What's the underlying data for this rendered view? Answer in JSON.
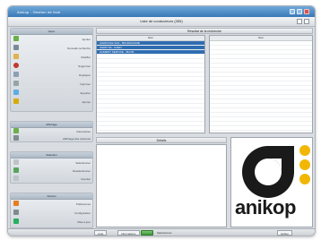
{
  "window": {
    "title": "Anikop - Gestion de liste",
    "subtitle": "Liste de conducteurs (355)"
  },
  "sidebar": {
    "sections": [
      {
        "title": "Gérer",
        "items": [
          "Ajouter",
          "Nouvelle recherche",
          "Modifier",
          "Supprimer",
          "Dupliquer",
          "Imprimer",
          "Exporter",
          "Aperçu"
        ]
      },
      {
        "title": "Affichage",
        "items": [
          "Paramètres",
          "Affichage des colonnes"
        ]
      },
      {
        "title": "Sélection",
        "items": [
          "Sélectionner",
          "Désélectionner",
          "Inverser"
        ]
      },
      {
        "title": "Options",
        "items": [
          "Préférences",
          "Configuration",
          "Mise à jour"
        ]
      }
    ]
  },
  "main": {
    "list_title": "Résultat de la recherche",
    "left_col": "Nom",
    "right_col": "Nom",
    "selected_rows": [
      "AGRICOLE SAS - BOURGOGNE",
      "AGRO SA - CAEN",
      "ALIMENT SERVICE - BLOIS"
    ],
    "detail_title": "Détails"
  },
  "logo": {
    "text": "anikop"
  },
  "status": {
    "tab1": "Liste",
    "tab2": "Informations",
    "left_text": "Sélectionner",
    "right_text": "Quitter"
  },
  "colors": {
    "accent": "#3a78b7",
    "selection": "#2f6db1",
    "logo_dot": "#f2b705"
  }
}
